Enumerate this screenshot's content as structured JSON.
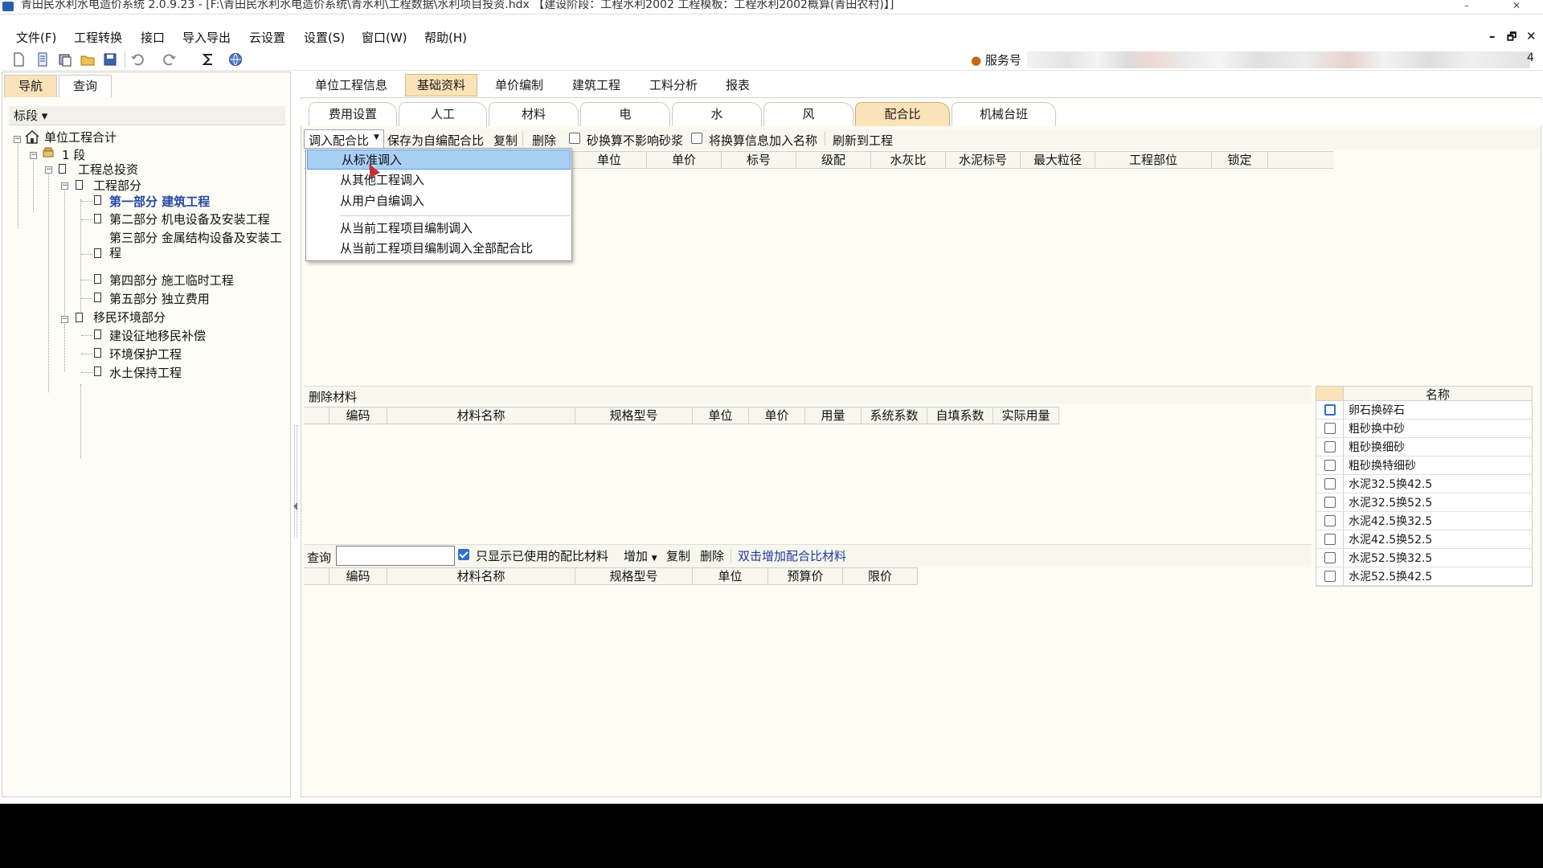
{
  "titlebar": {
    "text": "青田民水利水电造价系统 2.0.9.23 - [F:\\青田民水利水电造价系统\\青水利\\工程数据\\水利项目投资.hdx 【建设阶段：工程水利2002 工程模板：工程水利2002概算(青田农村)】]",
    "window_controls": [
      "–",
      "✕"
    ]
  },
  "menubar": {
    "items": [
      "文件(F)",
      "工程转换",
      "接口",
      "导入导出",
      "云设置",
      "设置(S)",
      "窗口(W)",
      "帮助(H)"
    ],
    "window_buttons": [
      "–",
      "🗗",
      "✕"
    ]
  },
  "toolbar": {
    "icons": [
      "new-icon",
      "open-doc-icon",
      "save-as-icon",
      "folder-open-icon",
      "save-icon",
      "undo-icon",
      "redo-icon",
      "sigma-icon",
      "globe-icon"
    ],
    "service_label": "服务号",
    "service_tail": "4"
  },
  "left_panel": {
    "tabs": [
      "导航",
      "查询"
    ],
    "segment_label": "标段 ▾",
    "tree": {
      "root": "单位工程合计",
      "n1": "1 段",
      "n2": "工程总投资",
      "n3": "工程部分",
      "leaf1": "第一部分 建筑工程",
      "leaf2": "第二部分 机电设备及安装工程",
      "leaf3a": "第三部分 金属结构设备及安装工",
      "leaf3b": "程",
      "leaf4": "第四部分 施工临时工程",
      "leaf5": "第五部分 独立费用",
      "n4": "移民环境部分",
      "leaf6": "建设征地移民补偿",
      "leaf7": "环境保护工程",
      "leaf8": "水土保持工程"
    }
  },
  "top_tabs": [
    "单位工程信息",
    "基础资料",
    "单价编制",
    "建筑工程",
    "工料分析",
    "报表"
  ],
  "sub_tabs": [
    "费用设置",
    "人工",
    "材料",
    "电",
    "水",
    "风",
    "配合比",
    "机械台班"
  ],
  "action_bar": {
    "import_dropdown": "调入配合比",
    "save_custom": "保存为自编配合比",
    "copy": "复制",
    "delete": "删除",
    "chk1": "砂换算不影响砂浆",
    "chk2": "将换算信息加入名称",
    "refresh": "刷新到工程"
  },
  "mix_columns": [
    "单位",
    "单价",
    "标号",
    "级配",
    "水灰比",
    "水泥标号",
    "最大粒径",
    "工程部位",
    "锁定"
  ],
  "dropdown_menu": {
    "items": [
      "从标准调入",
      "从其他工程调入",
      "从用户自编调入",
      "从当前工程项目编制调入",
      "从当前工程项目编制调入全部配合比"
    ]
  },
  "material_section": {
    "label": "删除材料",
    "columns": [
      "编码",
      "材料名称",
      "规格型号",
      "单位",
      "单价",
      "用量",
      "系统系数",
      "自填系数",
      "实际用量"
    ]
  },
  "query_bar": {
    "label": "查询",
    "input_value": "",
    "only_used": "只显示已使用的配比材料",
    "add": "增加",
    "copy": "复制",
    "delete": "删除",
    "dblclick_hint": "双击增加配合比材料"
  },
  "lower_columns": [
    "编码",
    "材料名称",
    "规格型号",
    "单位",
    "预算价",
    "限价"
  ],
  "right_list": {
    "header": "名称",
    "items": [
      "卵石换碎石",
      "粗砂换中砂",
      "粗砂换细砂",
      "粗砂换特细砂",
      "水泥32.5换42.5",
      "水泥32.5换52.5",
      "水泥42.5换32.5",
      "水泥42.5换52.5",
      "水泥52.5换32.5",
      "水泥52.5换42.5"
    ]
  },
  "colors": {
    "active_tab": "#fbe3b9",
    "panel_bg": "#fdfdf3",
    "highlight": "#a9cff5",
    "link": "#1f3a9e"
  }
}
